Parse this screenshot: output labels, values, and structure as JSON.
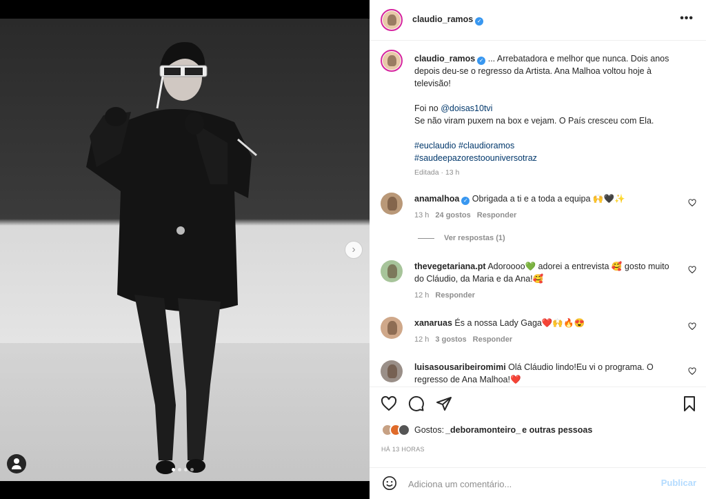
{
  "post": {
    "username": "claudio_ramos",
    "verified_icon": "verified-badge-icon",
    "more_icon": "more-options-icon",
    "more_label": "•••"
  },
  "caption": {
    "username": "claudio_ramos",
    "line1": "... Arrebatadora e melhor que nunca. Dois anos depois deu-se o regresso da Artista. Ana Malhoa voltou hoje à televisão!",
    "line2_prefix": "Foi no ",
    "mention": "@doisas10tvi",
    "line3": "Se não viram puxem na box e vejam. O País cresceu com Ela.",
    "hashtags_line1": "#euclaudio #claudioramos",
    "hashtags_line2": "#saudeepazorestoouniversotraz",
    "edited": "Editada · 13 h"
  },
  "comments": [
    {
      "username": "anamalhoa",
      "verified": true,
      "text": "Obrigada a ti e a toda a equipa 🙌🖤✨",
      "time": "13 h",
      "likes": "24 gostos",
      "reply": "Responder"
    },
    {
      "username": "thevegetariana.pt",
      "text": "Adoroooo💚 adorei a entrevista 🥰 gosto muito do Cláudio, da Maria e da Ana!🥰",
      "time": "12 h",
      "reply": "Responder"
    },
    {
      "username": "xanaruas",
      "text": "És a nossa Lady Gaga❤️🙌🔥😍",
      "time": "12 h",
      "likes": "3 gostos",
      "reply": "Responder"
    },
    {
      "username": "luisasousaribeiromimi",
      "text": "Olá Cláudio lindo!Eu vi o programa. O regresso de Ana Malhoa!❤️"
    }
  ],
  "view_replies": "Ver respostas (1)",
  "likes": {
    "prefix": "Gostos: ",
    "user": "_deboramonteiro_",
    "suffix": " e outras pessoas"
  },
  "time_ago": "HÁ 13 HORAS",
  "comment_input": {
    "placeholder": "Adiciona um comentário...",
    "post_label": "Publicar"
  },
  "carousel": {
    "total": 4,
    "active": 1
  },
  "colors": {
    "link": "#00376b",
    "verified": "#3897f0",
    "publish_disabled": "#b3dbff",
    "muted": "#8e8e8e"
  }
}
